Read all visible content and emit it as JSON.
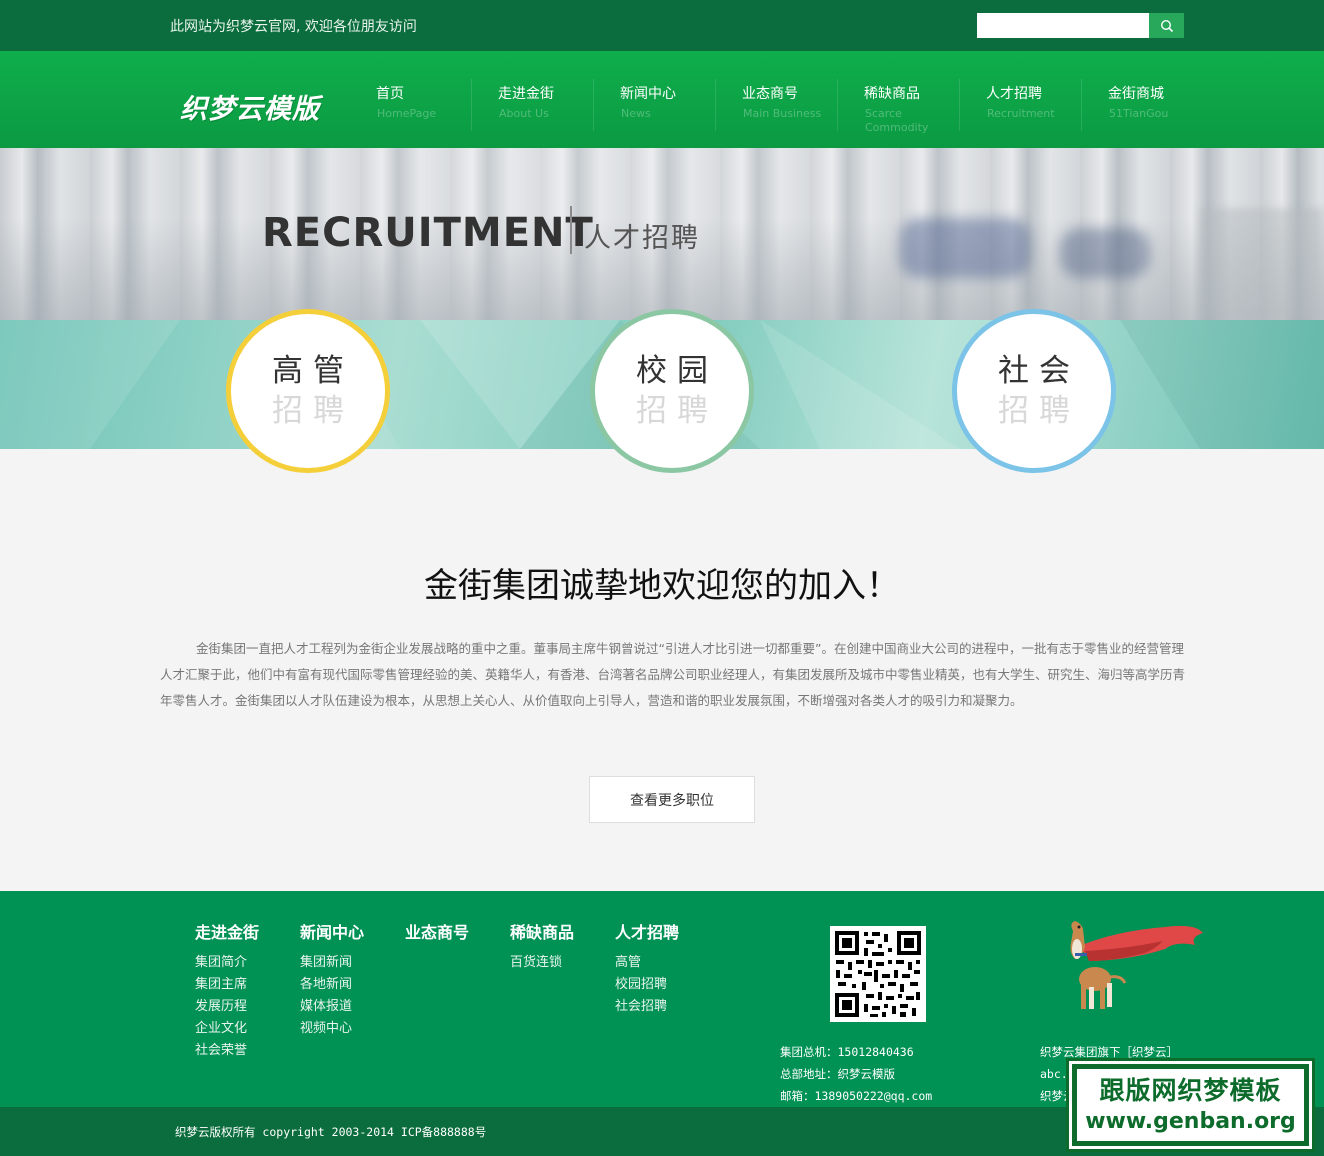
{
  "topbar": {
    "welcome": "此网站为织梦云官网, 欢迎各位朋友访问",
    "search_placeholder": "",
    "search_icon": "search-icon"
  },
  "header": {
    "logo": "织梦云模版"
  },
  "nav": [
    {
      "cn": "首页",
      "en": "HomePage"
    },
    {
      "cn": "走进金街",
      "en": "About Us"
    },
    {
      "cn": "新闻中心",
      "en": "News"
    },
    {
      "cn": "业态商号",
      "en": "Main Business"
    },
    {
      "cn": "稀缺商品",
      "en": "Scarce Commodity"
    },
    {
      "cn": "人才招聘",
      "en": "Recruitment"
    },
    {
      "cn": "金街商城",
      "en": "51TianGou"
    }
  ],
  "banner": {
    "title_en": "RECRUITMENT",
    "title_cn": "人才招聘"
  },
  "circles": [
    {
      "line1": "高管",
      "line2": "招聘",
      "border_color": "#f4cf3a"
    },
    {
      "line1": "校园",
      "line2": "招聘",
      "border_color": "#8cc7a4"
    },
    {
      "line1": "社会",
      "line2": "招聘",
      "border_color": "#7cc3e8"
    }
  ],
  "main": {
    "headline": "金街集团诚挚地欢迎您的加入！",
    "intro": "金街集团一直把人才工程列为金街企业发展战略的重中之重。董事局主席牛钢曾说过“引进人才比引进一切都重要”。在创建中国商业大公司的进程中，一批有志于零售业的经营管理人才汇聚于此，他们中有富有现代国际零售管理经验的美、英籍华人，有香港、台湾著名品牌公司职业经理人，有集团发展所及城市中零售业精英，也有大学生、研究生、海归等高学历青年零售人才。金街集团以人才队伍建设为根本，从思想上关心人、从价值取向上引导人，营造和谐的职业发展氛围，不断增强对各类人才的吸引力和凝聚力。",
    "more_button": "查看更多职位"
  },
  "footer": {
    "columns": [
      {
        "head": "走进金街",
        "links": [
          "集团简介",
          "集团主席",
          "发展历程",
          "企业文化",
          "社会荣誉"
        ]
      },
      {
        "head": "新闻中心",
        "links": [
          "集团新闻",
          "各地新闻",
          "媒体报道",
          "视频中心"
        ]
      },
      {
        "head": "业态商号",
        "links": []
      },
      {
        "head": "稀缺商品",
        "links": [
          "百货连锁"
        ]
      },
      {
        "head": "人才招聘",
        "links": [
          "高管",
          "校园招聘",
          "社会招聘"
        ]
      }
    ],
    "contact": {
      "phone": "集团总机：15012840436",
      "address": "总部地址：织梦云模版",
      "email": "邮箱：1389050222@qq.com"
    },
    "brand": {
      "line1": "织梦云集团旗下［织梦云］",
      "line2": "abc.c",
      "line3": "织梦云"
    },
    "copyright": "织梦云版权所有 copyright 2003-2014 ICP备888888号"
  },
  "watermark": {
    "line1": "跟版网织梦模板",
    "line2": "www.genban.org"
  },
  "colors": {
    "topbar": "#0b6d3d",
    "nav_green": "#0fae4c",
    "footer_green": "#009155"
  }
}
